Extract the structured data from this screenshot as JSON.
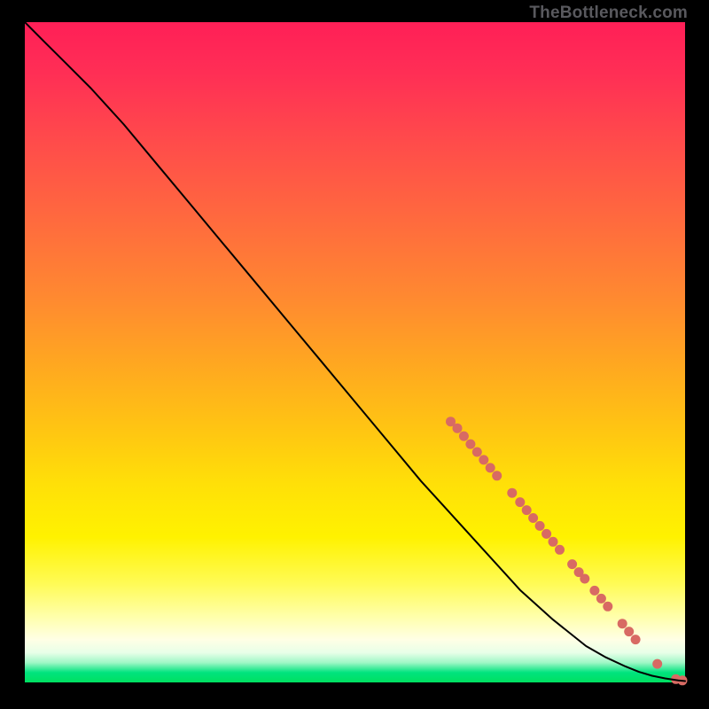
{
  "watermark": "TheBottleneck.com",
  "chart_data": {
    "type": "line",
    "title": "",
    "xlabel": "",
    "ylabel": "",
    "xlim": [
      0,
      100
    ],
    "ylim": [
      0,
      100
    ],
    "grid": false,
    "legend": "none",
    "series": [
      {
        "name": "curve",
        "color": "#000000",
        "stroke_width": 2,
        "x": [
          0,
          3,
          6,
          10,
          15,
          20,
          25,
          30,
          35,
          40,
          45,
          50,
          55,
          60,
          65,
          70,
          75,
          80,
          85,
          88,
          91,
          93,
          95,
          97,
          99,
          100
        ],
        "y": [
          100,
          97,
          94,
          90,
          84.5,
          78.5,
          72.5,
          66.5,
          60.5,
          54.5,
          48.5,
          42.5,
          36.5,
          30.5,
          25,
          19.5,
          14,
          9.5,
          5.5,
          3.8,
          2.4,
          1.6,
          1.0,
          0.6,
          0.3,
          0.2
        ]
      }
    ],
    "markers": {
      "name": "highlighted-segments",
      "color": "#d86a63",
      "radius": 5.5,
      "points": [
        {
          "x": 64.5,
          "y": 39.5
        },
        {
          "x": 65.5,
          "y": 38.5
        },
        {
          "x": 66.5,
          "y": 37.3
        },
        {
          "x": 67.5,
          "y": 36.1
        },
        {
          "x": 68.5,
          "y": 34.9
        },
        {
          "x": 69.5,
          "y": 33.7
        },
        {
          "x": 70.5,
          "y": 32.5
        },
        {
          "x": 71.5,
          "y": 31.3
        },
        {
          "x": 73.8,
          "y": 28.7
        },
        {
          "x": 75.0,
          "y": 27.3
        },
        {
          "x": 76.0,
          "y": 26.1
        },
        {
          "x": 77.0,
          "y": 24.9
        },
        {
          "x": 78.0,
          "y": 23.7
        },
        {
          "x": 79.0,
          "y": 22.5
        },
        {
          "x": 80.0,
          "y": 21.3
        },
        {
          "x": 81.0,
          "y": 20.1
        },
        {
          "x": 82.9,
          "y": 17.9
        },
        {
          "x": 83.9,
          "y": 16.7
        },
        {
          "x": 84.8,
          "y": 15.7
        },
        {
          "x": 86.3,
          "y": 13.9
        },
        {
          "x": 87.3,
          "y": 12.7
        },
        {
          "x": 88.3,
          "y": 11.5
        },
        {
          "x": 90.5,
          "y": 8.9
        },
        {
          "x": 91.5,
          "y": 7.7
        },
        {
          "x": 92.5,
          "y": 6.5
        },
        {
          "x": 95.8,
          "y": 2.8
        },
        {
          "x": 98.6,
          "y": 0.5
        },
        {
          "x": 99.6,
          "y": 0.3
        }
      ]
    }
  }
}
